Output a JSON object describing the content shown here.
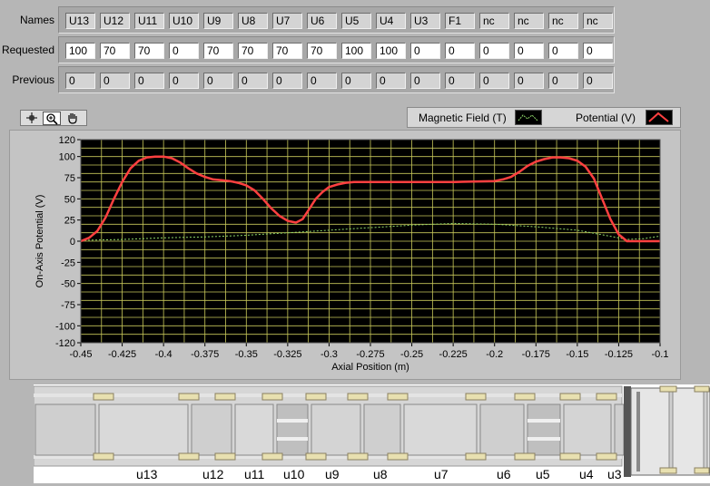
{
  "table": {
    "names_label": "Names",
    "requested_label": "Requested",
    "previous_label": "Previous",
    "names": [
      "U13",
      "U12",
      "U11",
      "U10",
      "U9",
      "U8",
      "U7",
      "U6",
      "U5",
      "U4",
      "U3",
      "F1",
      "nc",
      "nc",
      "nc",
      "nc"
    ],
    "requested": [
      "100",
      "70",
      "70",
      "0",
      "70",
      "70",
      "70",
      "70",
      "100",
      "100",
      "0",
      "0",
      "0",
      "0",
      "0",
      "0"
    ],
    "previous": [
      "0",
      "0",
      "0",
      "0",
      "0",
      "0",
      "0",
      "0",
      "0",
      "0",
      "0",
      "0",
      "0",
      "0",
      "0",
      "0"
    ]
  },
  "toolbar": {
    "icons": [
      "cursor-crosshair-icon",
      "zoom-icon",
      "pan-hand-icon"
    ]
  },
  "legend": {
    "magnetic_label": "Magnetic Field (T)",
    "potential_label": "Potential (V)"
  },
  "colors": {
    "plot_bg": "#000000",
    "grid": "#c8c85a",
    "potential": "#ff4040",
    "magnetic": "#8fd86a"
  },
  "chart_data": {
    "type": "line",
    "xlabel": "Axial Position (m)",
    "ylabel": "On-Axis Potential (V)",
    "xlim": [
      -0.45,
      -0.1
    ],
    "ylim": [
      -120,
      120
    ],
    "grid": true,
    "x_ticks": [
      "-0.45",
      "-0.425",
      "-0.4",
      "-0.375",
      "-0.35",
      "-0.325",
      "-0.3",
      "-0.275",
      "-0.25",
      "-0.225",
      "-0.2",
      "-0.175",
      "-0.15",
      "-0.125",
      "-0.1"
    ],
    "y_ticks": [
      "120",
      "100",
      "75",
      "50",
      "25",
      "0",
      "-25",
      "-50",
      "-75",
      "-100",
      "-120"
    ],
    "series": [
      {
        "name": "Potential (V)",
        "x": [
          -0.45,
          -0.445,
          -0.44,
          -0.435,
          -0.43,
          -0.425,
          -0.42,
          -0.415,
          -0.41,
          -0.405,
          -0.4,
          -0.395,
          -0.39,
          -0.385,
          -0.38,
          -0.375,
          -0.37,
          -0.365,
          -0.36,
          -0.355,
          -0.35,
          -0.345,
          -0.34,
          -0.335,
          -0.33,
          -0.325,
          -0.32,
          -0.316,
          -0.312,
          -0.308,
          -0.304,
          -0.3,
          -0.295,
          -0.29,
          -0.285,
          -0.28,
          -0.275,
          -0.27,
          -0.25,
          -0.225,
          -0.2,
          -0.195,
          -0.19,
          -0.185,
          -0.18,
          -0.175,
          -0.17,
          -0.165,
          -0.16,
          -0.155,
          -0.15,
          -0.145,
          -0.14,
          -0.135,
          -0.13,
          -0.125,
          -0.12,
          -0.115,
          -0.11,
          -0.105,
          -0.1
        ],
        "y": [
          0,
          4,
          12,
          28,
          50,
          70,
          86,
          95,
          99,
          100,
          100,
          98,
          93,
          86,
          80,
          76,
          73,
          72,
          71,
          69,
          66,
          60,
          50,
          39,
          30,
          24,
          22,
          26,
          38,
          50,
          58,
          64,
          67,
          69,
          70,
          70,
          70,
          70,
          70,
          70,
          71,
          73,
          76,
          82,
          89,
          94,
          97,
          99,
          99,
          98,
          95,
          88,
          74,
          50,
          26,
          8,
          0,
          0,
          0,
          0,
          0
        ]
      },
      {
        "name": "Magnetic Field (T)",
        "x": [
          -0.45,
          -0.425,
          -0.4,
          -0.375,
          -0.35,
          -0.325,
          -0.3,
          -0.275,
          -0.25,
          -0.225,
          -0.2,
          -0.175,
          -0.15,
          -0.125,
          -0.12,
          -0.11,
          -0.1
        ],
        "y": [
          1,
          2,
          4,
          5,
          7,
          10,
          13,
          16,
          19,
          21,
          20,
          17,
          13,
          4,
          2,
          3,
          6
        ]
      }
    ]
  },
  "diagram": {
    "labels": [
      "u13",
      "u12",
      "u11",
      "u10",
      "u9",
      "u8",
      "u7",
      "u6",
      "u5",
      "u4",
      "u3"
    ]
  }
}
